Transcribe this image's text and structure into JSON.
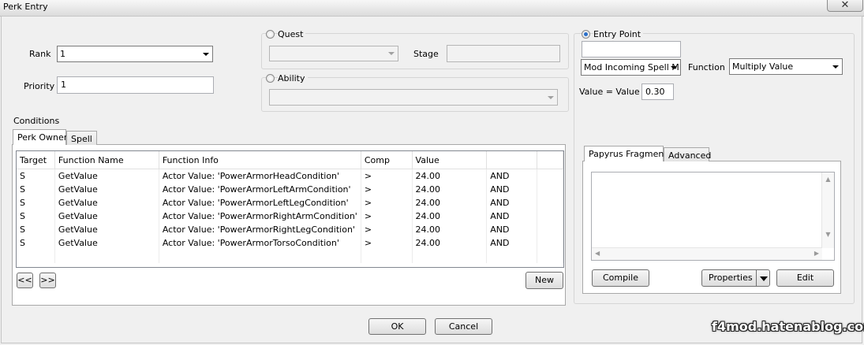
{
  "window": {
    "title": "Perk Entry",
    "close_glyph": "✕"
  },
  "rank": {
    "label": "Rank",
    "value": "1"
  },
  "priority": {
    "label": "Priority",
    "value": "1"
  },
  "quest": {
    "label": "Quest",
    "stage_label": "Stage",
    "value": "",
    "stage_value": ""
  },
  "ability": {
    "label": "Ability",
    "value": ""
  },
  "entry_point": {
    "label": "Entry Point",
    "name_value": "",
    "entry_value": "Mod Incoming Spell M",
    "function_label": "Function",
    "function_value": "Multiply Value",
    "expression_label": "Value = Value *",
    "expression_value": "0.30"
  },
  "conditions": {
    "label": "Conditions",
    "tabs": [
      "Perk Owner",
      "Spell"
    ],
    "columns": [
      "Target",
      "Function Name",
      "Function Info",
      "Comp",
      "Value",
      ""
    ],
    "rows": [
      [
        "S",
        "GetValue",
        "Actor Value: 'PowerArmorHeadCondition'",
        ">",
        "24.00",
        "AND"
      ],
      [
        "S",
        "GetValue",
        "Actor Value: 'PowerArmorLeftArmCondition'",
        ">",
        "24.00",
        "AND"
      ],
      [
        "S",
        "GetValue",
        "Actor Value: 'PowerArmorLeftLegCondition'",
        ">",
        "24.00",
        "AND"
      ],
      [
        "S",
        "GetValue",
        "Actor Value: 'PowerArmorRightArmCondition'",
        ">",
        "24.00",
        "AND"
      ],
      [
        "S",
        "GetValue",
        "Actor Value: 'PowerArmorRightLegCondition'",
        ">",
        "24.00",
        "AND"
      ],
      [
        "S",
        "GetValue",
        "Actor Value: 'PowerArmorTorsoCondition'",
        ">",
        "24.00",
        "AND"
      ]
    ],
    "move_up_label": "<<",
    "move_down_label": ">>",
    "new_label": "New"
  },
  "papyrus": {
    "tabs": [
      "Papyrus Fragment",
      "Advanced"
    ],
    "text": "",
    "compile_label": "Compile",
    "properties_label": "Properties",
    "edit_label": "Edit"
  },
  "footer": {
    "ok_label": "OK",
    "cancel_label": "Cancel"
  },
  "watermark": "f4mod.hatenablog.com"
}
